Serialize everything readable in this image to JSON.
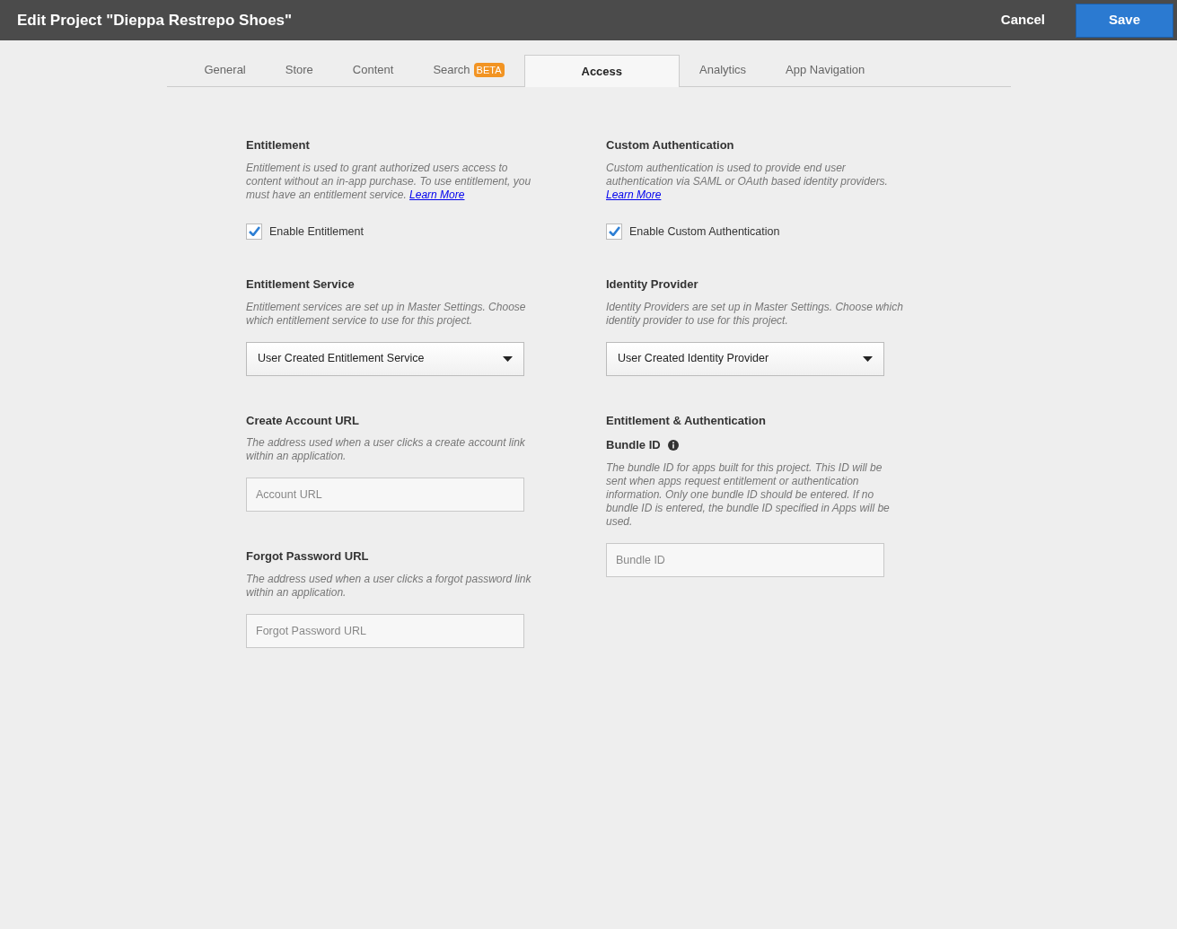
{
  "header": {
    "title": "Edit Project \"Dieppa Restrepo Shoes\"",
    "cancel": "Cancel",
    "save": "Save"
  },
  "tabs": [
    {
      "label": "General",
      "selected": false
    },
    {
      "label": "Store",
      "selected": false
    },
    {
      "label": "Content",
      "selected": false
    },
    {
      "label": "Search",
      "badge": "BETA",
      "selected": false
    },
    {
      "label": "Access",
      "selected": true
    },
    {
      "label": "Analytics",
      "selected": false
    },
    {
      "label": "App Navigation",
      "selected": false
    }
  ],
  "columns": [
    [
      {
        "kind": "heading",
        "text": "Entitlement"
      },
      {
        "kind": "description",
        "text": "Entitlement is used to grant authorized users access to content without an  in-app purchase. To use  entitlement, you must have an entitlement service. ",
        "link": "Learn More"
      },
      {
        "kind": "checkbox",
        "label": "Enable Entitlement",
        "checked": true
      },
      {
        "kind": "heading",
        "text": "Entitlement Service"
      },
      {
        "kind": "description",
        "text": "Entitlement services are set up in Master Settings. Choose which entitlement service to use for this  project."
      },
      {
        "kind": "select",
        "value": "User Created Entitlement Service"
      },
      {
        "kind": "heading",
        "text": "Create Account URL"
      },
      {
        "kind": "description",
        "text": "The address used when a user clicks a create account link within an application."
      },
      {
        "kind": "input",
        "placeholder": "Account URL"
      },
      {
        "kind": "heading",
        "text": "Forgot Password URL"
      },
      {
        "kind": "description",
        "text": "The address used when a user clicks a forgot password link within an application."
      },
      {
        "kind": "input",
        "placeholder": "Forgot Password URL"
      }
    ],
    [
      {
        "kind": "heading",
        "text": "Custom Authentication"
      },
      {
        "kind": "description",
        "text": "Custom authentication is used to provide end user authentication via SAML or OAuth based identity providers. ",
        "link": "Learn More"
      },
      {
        "kind": "checkbox",
        "label": "Enable Custom Authentication",
        "checked": true
      },
      {
        "kind": "heading",
        "text": "Identity Provider"
      },
      {
        "kind": "description",
        "text": "Identity Providers are set up in Master Settings.  Choose which identity provider to use for this project."
      },
      {
        "kind": "select",
        "value": "User Created Identity Provider"
      },
      {
        "kind": "heading",
        "text": "Entitlement & Authentication"
      },
      {
        "kind": "info_heading",
        "text": "Bundle ID"
      },
      {
        "kind": "description",
        "text": "The bundle ID for apps built for this project. This ID will be sent when apps request entitlement or authentication information. Only one bundle ID should be entered. If no bundle ID is entered, the bundle ID specified in Apps will be used."
      },
      {
        "kind": "input",
        "placeholder": "Bundle ID"
      }
    ]
  ]
}
